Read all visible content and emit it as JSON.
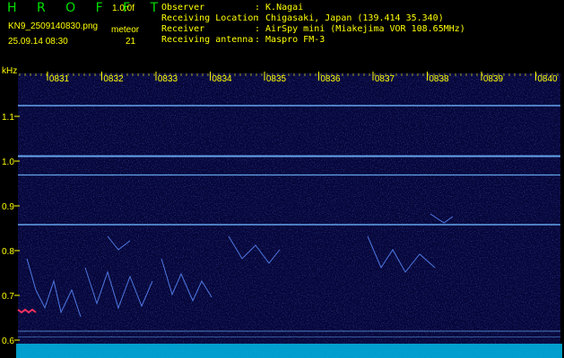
{
  "header": {
    "app_title": "H R O F F T",
    "version": "1.0.0f",
    "file_name": "KN9_2509140830.png",
    "datetime": "25.09.14 08:30",
    "meteor_label": "meteor",
    "meteor_count": "21"
  },
  "info": [
    {
      "key": "Observer",
      "value": ": K.Nagai"
    },
    {
      "key": "Receiving Location",
      "value": ": Chigasaki, Japan (139.414 35.340)"
    },
    {
      "key": "Receiver",
      "value": ": AirSpy mini (Miakejima VOR 108.65MHz)"
    },
    {
      "key": "Receiving antenna",
      "value": ": Maspro FM-3"
    }
  ],
  "axis": {
    "unit": "kHz",
    "freq_ticks": [
      "1.1",
      "1.0",
      "0.9",
      "0.8",
      "0.7",
      "0.6"
    ],
    "time_ticks": [
      "0831",
      "0832",
      "0833",
      "0834",
      "0835",
      "0836",
      "0837",
      "0838",
      "0839",
      "0840"
    ]
  },
  "colors": {
    "background": "#000000",
    "plot": "#06063a",
    "label": "#ffff00",
    "title": "#00e000",
    "carrier": "#50a0ff"
  }
}
